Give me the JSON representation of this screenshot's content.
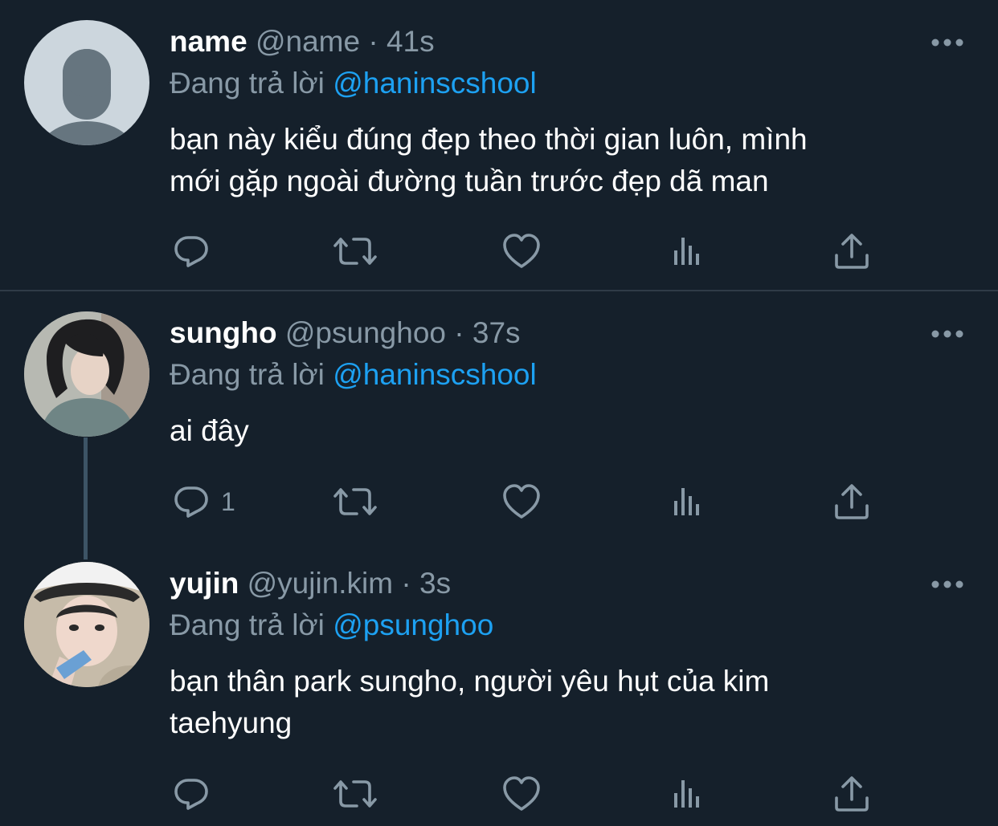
{
  "colors": {
    "background": "#15202b",
    "secondary_text": "#8899a6",
    "mention": "#1da1f2",
    "divider": "#2f3b47"
  },
  "tweets": [
    {
      "name": "name",
      "handle": "@name",
      "separator": "·",
      "time": "41s",
      "reply_prefix": "Đang trả lời",
      "reply_to": "@haninscshool",
      "text_lines": [
        "bạn này kiểu đúng đẹp theo thời gian luôn, mình",
        "mới gặp ngoài đường tuần trước đẹp dã man"
      ],
      "reply_count": ""
    },
    {
      "name": "sungho",
      "handle": "@psunghoo",
      "separator": "·",
      "time": "37s",
      "reply_prefix": "Đang trả lời",
      "reply_to": "@haninscshool",
      "text_lines": [
        "ai đây"
      ],
      "reply_count": "1"
    },
    {
      "name": "yujin",
      "handle": "@yujin.kim",
      "separator": "·",
      "time": "3s",
      "reply_prefix": "Đang trả lời",
      "reply_to": "@psunghoo",
      "text_lines": [
        "bạn thân park sungho, người yêu hụt của kim",
        "taehyung"
      ],
      "reply_count": ""
    }
  ],
  "icons": {
    "more": "more-horizontal-icon",
    "reply": "reply-bubble-icon",
    "retweet": "retweet-icon",
    "like": "heart-icon",
    "analytics": "analytics-icon",
    "share": "share-upload-icon"
  }
}
